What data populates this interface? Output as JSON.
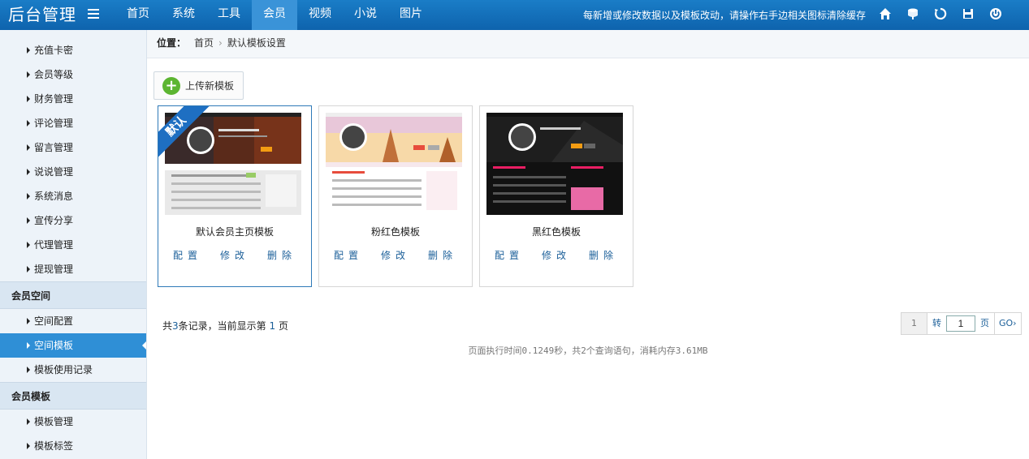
{
  "app": {
    "title": "后台管理"
  },
  "nav": {
    "items": [
      "首页",
      "系统",
      "工具",
      "会员",
      "视频",
      "小说",
      "图片"
    ],
    "active_index": 3
  },
  "top_notice": "每新增或修改数据以及模板改动，请操作右手边相关图标清除缓存",
  "top_icons": [
    "home-icon",
    "clear-cache-icon",
    "refresh-icon",
    "save-icon",
    "power-icon"
  ],
  "sidebar": {
    "group1_items": [
      "充值卡密",
      "会员等级",
      "财务管理",
      "评论管理",
      "留言管理",
      "说说管理",
      "系统消息",
      "宣传分享",
      "代理管理",
      "提现管理"
    ],
    "group2_title": "会员空间",
    "group2_items": [
      "空间配置",
      "空间模板",
      "模板使用记录"
    ],
    "group2_active_index": 1,
    "group3_title": "会员模板",
    "group3_items": [
      "模板管理",
      "模板标签"
    ]
  },
  "breadcrumb": {
    "label": "位置：",
    "home": "首页",
    "current": "默认模板设置"
  },
  "upload_button": "上传新模板",
  "templates": [
    {
      "name": "默认会员主页模板",
      "ribbon": "默认",
      "actions": [
        "配置",
        "修改",
        "删除"
      ],
      "theme": "dark-orange"
    },
    {
      "name": "粉红色模板",
      "actions": [
        "配置",
        "修改",
        "删除"
      ],
      "theme": "pink"
    },
    {
      "name": "黑红色模板",
      "actions": [
        "配置",
        "修改",
        "删除"
      ],
      "theme": "black-red"
    }
  ],
  "records": {
    "prefix": "共",
    "count": "3",
    "middle": "条记录，当前显示第",
    "page": "1",
    "suffix": "页"
  },
  "pager": {
    "current": "1",
    "jump_label": "转",
    "input_value": "1",
    "page_label": "页",
    "go_label": "GO›"
  },
  "exec_info": "页面执行时间0.1249秒，共2个查询语句，消耗内存3.61MB",
  "colors": {
    "topbar": "#0e63ad",
    "nav_active": "#3a93d8",
    "sidebar_active": "#2f8fd6",
    "link": "#1b5f99",
    "ribbon": "#1e6fc2"
  }
}
